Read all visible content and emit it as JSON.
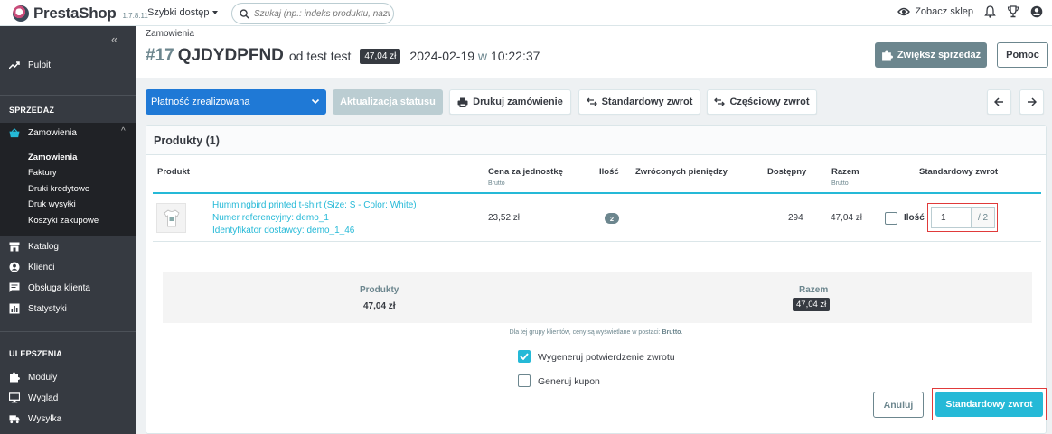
{
  "topbar": {
    "brand": "PrestaShop",
    "version": "1.7.8.11",
    "quick_access": "Szybki dostęp",
    "search_placeholder": "Szukaj (np.: indeks produktu, nazwa k",
    "view_shop": "Zobacz sklep"
  },
  "sidebar": {
    "dashboard": "Pulpit",
    "section_sell": "SPRZEDAŻ",
    "orders": "Zamowienia",
    "sub": [
      "Zamowienia",
      "Faktury",
      "Druki kredytowe",
      "Druk wysyłki",
      "Koszyki zakupowe"
    ],
    "catalog": "Katalog",
    "customers": "Klienci",
    "customer_service": "Obsługa klienta",
    "stats": "Statystyki",
    "section_improve": "ULEPSZENIA",
    "modules": "Moduły",
    "design": "Wygląd",
    "shipping": "Wysyłka"
  },
  "header": {
    "breadcrumb": "Zamowienia",
    "order_num": "#17",
    "order_ref": "QJDYDPFND",
    "from_customer": "od test test",
    "total_badge": "47,04 zł",
    "date": "2024-02-19",
    "at": "w",
    "time": "10:22:37",
    "grow_sales": "Zwiększ sprzedaż",
    "help": "Pomoc"
  },
  "toolbar": {
    "status": "Płatność zrealizowana",
    "update_status": "Aktualizacja statusu",
    "print": "Drukuj zamówienie",
    "standard_refund": "Standardowy zwrot",
    "partial_refund": "Częściowy zwrot"
  },
  "products": {
    "title": "Produkty (1)",
    "columns": {
      "product": "Produkt",
      "unit_price": "Cena za jednostkę",
      "unit_price_sub": "Brutto",
      "qty": "Ilość",
      "refunded": "Zwróconych pieniędzy",
      "available": "Dostępny",
      "total": "Razem",
      "total_sub": "Brutto",
      "standard_refund": "Standardowy zwrot"
    },
    "rows": [
      {
        "name": "Hummingbird printed t-shirt (Size: S - Color: White)",
        "reference": "Numer referencyjny: demo_1",
        "supplier_ref": "Identyfikator dostawcy: demo_1_46",
        "unit_price": "23,52 zł",
        "qty": "2",
        "available": "294",
        "total": "47,04 zł",
        "refund_label": "Ilość",
        "refund_value": "1",
        "refund_max": "/ 2"
      }
    ]
  },
  "summary": {
    "products_label": "Produkty",
    "products_value": "47,04 zł",
    "total_label": "Razem",
    "total_value": "47,04 zł"
  },
  "note_prefix": "Dla tej grupy klientów, ceny są wyświetlane w postaci:",
  "note_value": "Brutto",
  "options": {
    "regenerate": "Wygeneruj potwierdzenie zwrotu",
    "voucher": "Generuj kupon"
  },
  "actions": {
    "cancel": "Anuluj",
    "submit": "Standardowy zwrot"
  },
  "colors": {
    "accent": "#25b9d7",
    "sidebar": "#363a41",
    "highlight_border": "#e03a3a"
  }
}
